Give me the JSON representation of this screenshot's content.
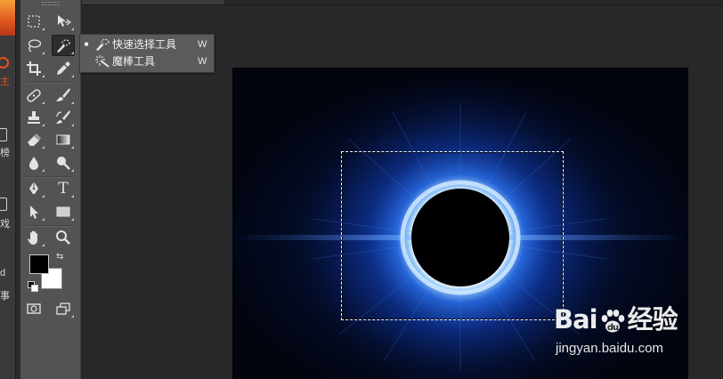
{
  "left_strip": {
    "items": [
      {
        "label": "主",
        "color": "#e8511e"
      },
      {
        "label": "榜"
      },
      {
        "label": "戏"
      },
      {
        "label": "d"
      },
      {
        "label": "事"
      }
    ]
  },
  "toolbox": {
    "tools": [
      {
        "name": "rectangular-marquee-tool",
        "icon": "rect-marquee-icon"
      },
      {
        "name": "move-tool",
        "icon": "move-icon"
      },
      {
        "name": "lasso-tool",
        "icon": "lasso-icon"
      },
      {
        "name": "quick-selection-tool",
        "icon": "quick-selection-icon",
        "active": true
      },
      {
        "name": "crop-tool",
        "icon": "crop-icon"
      },
      {
        "name": "eyedropper-tool",
        "icon": "eyedropper-icon"
      },
      {
        "name": "spot-healing-brush-tool",
        "icon": "bandage-icon"
      },
      {
        "name": "brush-tool",
        "icon": "brush-icon"
      },
      {
        "name": "clone-stamp-tool",
        "icon": "stamp-icon"
      },
      {
        "name": "history-brush-tool",
        "icon": "history-brush-icon"
      },
      {
        "name": "eraser-tool",
        "icon": "eraser-icon"
      },
      {
        "name": "gradient-tool",
        "icon": "gradient-icon"
      },
      {
        "name": "blur-tool",
        "icon": "blur-drop-icon"
      },
      {
        "name": "dodge-tool",
        "icon": "dodge-icon"
      },
      {
        "name": "pen-tool",
        "icon": "pen-icon"
      },
      {
        "name": "type-tool",
        "icon": "type-icon",
        "glyph": "T"
      },
      {
        "name": "path-selection-tool",
        "icon": "path-select-icon"
      },
      {
        "name": "rectangle-tool",
        "icon": "rectangle-shape-icon"
      },
      {
        "name": "hand-tool",
        "icon": "hand-icon"
      },
      {
        "name": "zoom-tool",
        "icon": "zoom-icon"
      },
      {
        "name": "quick-mask",
        "icon": "quick-mask-icon"
      },
      {
        "name": "screen-mode",
        "icon": "screen-mode-icon"
      }
    ],
    "foreground_color": "#000000",
    "background_color": "#ffffff",
    "swap_glyph": "⇆"
  },
  "flyout": {
    "items": [
      {
        "label": "快速选择工具",
        "shortcut": "W",
        "selected": true,
        "icon": "quick-selection-icon"
      },
      {
        "label": "魔棒工具",
        "shortcut": "W",
        "selected": false,
        "icon": "magic-wand-icon"
      }
    ],
    "bullet": "■"
  },
  "watermark": {
    "logo_left": "Bai",
    "logo_right": "经验",
    "url": "jingyan.baidu.com"
  }
}
